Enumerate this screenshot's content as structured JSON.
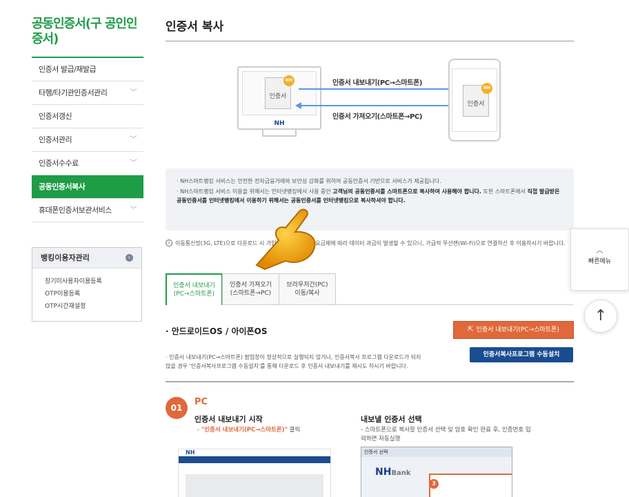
{
  "sidebar": {
    "title": "공동인증서(구 공인인증서)",
    "items": [
      {
        "label": "인증서 발급/재발급",
        "has_chevron": false,
        "active": false
      },
      {
        "label": "타행/타기관인증서관리",
        "has_chevron": true,
        "active": false
      },
      {
        "label": "인증서갱신",
        "has_chevron": false,
        "active": false
      },
      {
        "label": "인증서관리",
        "has_chevron": true,
        "active": false
      },
      {
        "label": "인증서수수료",
        "has_chevron": true,
        "active": false
      },
      {
        "label": "공동인증서복사",
        "has_chevron": false,
        "active": true
      },
      {
        "label": "휴대폰인증서보관서비스",
        "has_chevron": true,
        "active": false
      }
    ],
    "box": {
      "title": "뱅킹이용자관리",
      "links": [
        "장기미사용자이용등록",
        "OTP이용등록",
        "OTP시간재설정"
      ]
    }
  },
  "main": {
    "title": "인증서 복사",
    "illustration": {
      "cert_label": "인증서",
      "pc_brand": "NH",
      "export_label": "인증서 내보내기(PC→스마트폰)",
      "import_label": "인증서 가져오기(스마트폰→PC)"
    },
    "notice": {
      "line1": "· NH스마트뱅킹 서비스는 안전한 전자금융거래와 보안성 강화를 위하여 공동인증서 기반으로 서비스가 제공됩니다.",
      "line2a": "· NH스마트뱅킹 서비스 이용을 위해서는 인터넷뱅킹에서 사용 중인 ",
      "line2b": "고객님의 공동인증서를 스마트폰으로 복사하여 사용해야 합니다.",
      "line2c": " 또한 스마트폰에서 ",
      "line2d": "직접 발급받은 공동인증서를 인터넷뱅킹에서 이용하기 위해서는 공동인증서를 인터넷뱅킹으로 복사하셔야 합니다."
    },
    "info": "이동통신망(3G, LTE)으로 다운로드 시 가입하신 이동통신사 요금제에 따라 데이터 과금이 발생할 수 있으니, 가급적 무선랜(Wi-Fi)으로 연결하신 후 이용하시기 바랍니다.",
    "tabs": [
      {
        "line1": "인증서 내보내기",
        "line2": "(PC→스마트폰)",
        "active": true
      },
      {
        "line1": "인증서 가져오기",
        "line2": "(스마트폰→PC)",
        "active": false
      },
      {
        "line1": "브라우저간(PC)",
        "line2": "이동/복사",
        "active": false
      }
    ],
    "section": {
      "title": "· 안드로이드OS / 아이폰OS",
      "export_button": "인증서 내보내기(PC→스마트폰)",
      "desc": "· 인증서 내보내기(PC→스마트폰) 팝업창이 정상적으로 실행되지 않거나, 인증서복사 프로그램 다운로드가 되지 않을 경우 '인증서복사프로그램 수동설치'를 통해 다운로드 후 인증서 내보내기를 재시도 하시기 바랍니다.",
      "install_button": "인증서복사프로그램 수동설치"
    },
    "step": {
      "number": "01",
      "label": "PC",
      "sub1_title": "인증서 내보내기 시작",
      "sub1_prefix": "- ",
      "sub1_highlight": "\"인증서 내보내기(PC→스마트폰)\"",
      "sub1_suffix": " 클릭",
      "sub2_title": "내보낼 인증서 선택",
      "sub2_desc": "- 스마트폰으로 복사할 인증서 선택 및 암호 확인 완료 후, 인증번호 입력하면 자동실행",
      "shot2_window_title": "인증서 선택",
      "shot2_brand": "NH",
      "shot2_brand_sub": "Bank",
      "shot2_badge": "3"
    }
  },
  "float_menu": {
    "label": "빠른메뉴",
    "top_icon": "arrow-up-icon"
  },
  "colors": {
    "green": "#1e9c46",
    "orange": "#e0693b",
    "blue": "#1a4c91",
    "arrow": "#5c95e0"
  }
}
